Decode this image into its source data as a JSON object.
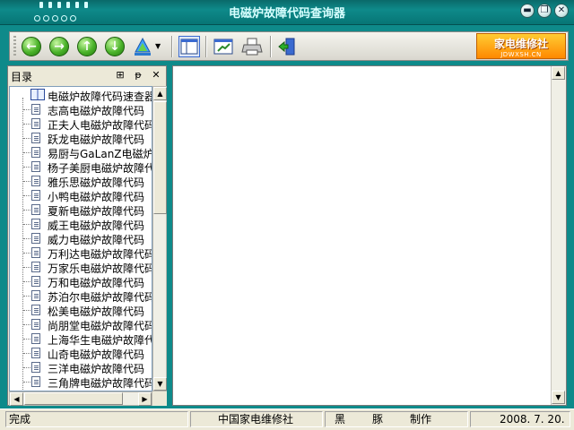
{
  "window": {
    "title": "电磁炉故障代码查询器",
    "controls": {
      "minimize": "▬",
      "restore": "❐",
      "close": "✕"
    }
  },
  "toolbar": {
    "buttons": [
      {
        "name": "back-button",
        "glyph": "←"
      },
      {
        "name": "forward-button",
        "glyph": "→"
      },
      {
        "name": "up-button",
        "glyph": "↑"
      },
      {
        "name": "down-button",
        "glyph": "↓"
      }
    ],
    "brand": {
      "main": "家电维修社",
      "sub": "JDWXSH.CN"
    }
  },
  "sidebar": {
    "title": "目录",
    "pin_glyph": "⊞",
    "autohide_glyph": "ᵽ",
    "close_glyph": "✕",
    "root": "电磁炉故障代码速查器",
    "items": [
      "志高电磁炉故障代码",
      "正夫人电磁炉故障代码",
      "跃龙电磁炉故障代码",
      "易厨与GaLanZ电磁炉故",
      "杨子美厨电磁炉故障代",
      "雅乐思磁炉故障代码",
      "小鸭电磁炉故障代码",
      "夏新电磁炉故障代码",
      "威王电磁炉故障代码",
      "威力电磁炉故障代码",
      "万利达电磁炉故障代码",
      "万家乐电磁炉故障代码",
      "万和电磁炉故障代码",
      "苏泊尔电磁炉故障代码",
      "松美电磁炉故障代码",
      "尚朋堂电磁炉故障代码",
      "上海华生电磁炉故障代",
      "山奇电磁炉故障代码",
      "三洋电磁炉故障代码",
      "三角牌电磁炉故障代码"
    ]
  },
  "statusbar": {
    "status": "完成",
    "org": "中国家电维修社",
    "author_a": "黑",
    "author_b": "豚",
    "made": "制作",
    "date": "2008. 7. 20."
  }
}
